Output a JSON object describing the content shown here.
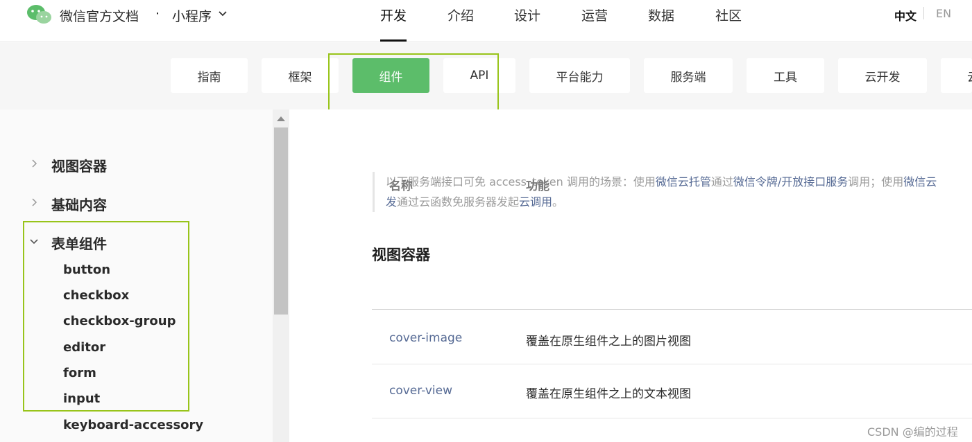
{
  "header": {
    "brand": "微信官方文档",
    "brand_dot": "·",
    "brand_sub": "小程序",
    "nav": [
      "开发",
      "介绍",
      "设计",
      "运营",
      "数据",
      "社区"
    ],
    "lang_zh": "中文",
    "lang_en": "EN"
  },
  "subnav": {
    "tabs": [
      "指南",
      "框架",
      "组件",
      "API",
      "平台能力",
      "服务端",
      "工具",
      "云开发",
      "云"
    ],
    "active": "组件"
  },
  "sidebar": {
    "groups": [
      "视图容器",
      "基础内容",
      "表单组件"
    ],
    "form_items": [
      "button",
      "checkbox",
      "checkbox-group",
      "editor",
      "form",
      "input",
      "keyboard-accessory"
    ]
  },
  "content": {
    "note_line1_a": "以下服务端接口可免 access_token 调用的场景：使用",
    "note_link1": "微信云托管",
    "note_line1_b": "通过",
    "note_link2": "微信令牌/开放接口服务",
    "note_line1_c": "调用；使用",
    "note_link3": "微信云",
    "note_link4": "发",
    "note_line2_a": "通过云函数免服务器发起",
    "note_link5": "云调用",
    "note_line2_b": "。",
    "section_title": "视图容器",
    "col_name": "名称",
    "col_desc": "功能",
    "rows": [
      {
        "name": "cover-image",
        "desc": "覆盖在原生组件之上的图片视图"
      },
      {
        "name": "cover-view",
        "desc": "覆盖在原生组件之上的文本视图"
      }
    ]
  },
  "watermark": "CSDN @编的过程",
  "colors": {
    "accent": "#5cbd6a",
    "highlight": "#98c41a",
    "link": "#576b95"
  }
}
